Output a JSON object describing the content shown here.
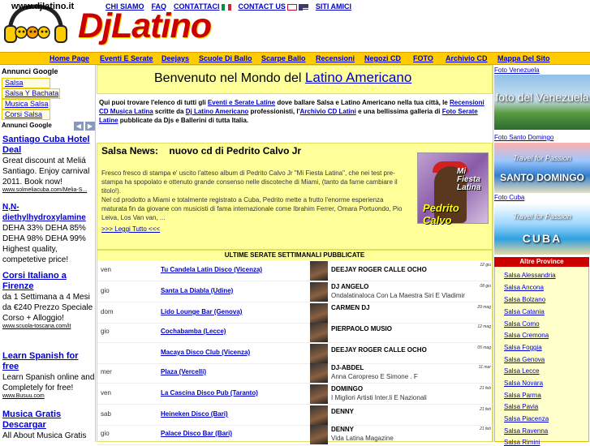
{
  "header": {
    "site_url": "www.djlatino.it",
    "brand": "DjLatino",
    "top_links": [
      "CHI SIAMO",
      "FAQ",
      "CONTATTACI",
      "CONTACT US",
      "SITI AMICI"
    ]
  },
  "nav": [
    "Home Page",
    "Eventi E Serate",
    "Deejays",
    "Scuole Di Ballo",
    "Scarpe Ballo",
    "Recensioni",
    "Negozi CD",
    "FOTO",
    "Archivio CD",
    "Mappa Del Sito"
  ],
  "left": {
    "annunci_title": "Annunci Google",
    "links": [
      "Salsa",
      "Salsa Y Bachata",
      "Musica Salsa",
      "Corsi Salsa"
    ],
    "annunci_label": "Annunci Google",
    "ads": [
      {
        "title": "Santiago Cuba Hotel Deal",
        "desc": "Great discount at Meliá Santiago. Enjoy carnival 2011. Book now!",
        "url": "www.solmeliacuba.com/Melia-S..."
      },
      {
        "title": "N,N-diethylhydroxylamine",
        "desc": "DEHA 33% DEHA 85% DEHA 98% DEHA 99% Highest quality, competetive price!",
        "url": ""
      },
      {
        "title": "Corsi Italiano a Firenze",
        "desc": "da 1 Settimana a 4 Mesi da €240 Prezzo Speciale Corso + Alloggio!",
        "url": "www.scuola-toscana.com/it"
      },
      {
        "title": "Learn Spanish for free",
        "desc": "Learn Spanish online and Completely for free!",
        "url": "www.Busuu.com"
      },
      {
        "title": "Musica Gratis Descargar",
        "desc": "All About Musica Gratis",
        "url": ""
      }
    ]
  },
  "main": {
    "welcome_prefix": "Benvenuto nel Mondo del",
    "welcome_link": "Latino Americano",
    "intro": {
      "p1": "Qui puoi trovare l'elenco di tutti gli",
      "l1": "Eventi e Serate Latine",
      "p2": "dove ballare Salsa e Latino Americano nella tua città, le",
      "l2": "Recensioni CD Musica Latina",
      "p3": "scritte da",
      "l3": "Dj Latino Americano",
      "p4": "professionisti, l'",
      "l4": "Archivio CD Latini",
      "p5": "e una bellissima galleria di",
      "l5": "Foto Serate Latine",
      "p6": "pubblicate da Djs e Ballerini di tutta Italia."
    },
    "news": {
      "label": "Salsa News:",
      "headline": "nuovo cd di Pedrito Calvo Jr",
      "body1": "Fresco fresco di stampa e' uscito l'atteso album di Pedrito Calvo Jr \"Mi Fiesta Latina\", che nei test pre-stampa ha spopolato e ottenuto grande consenso nelle discoteche di Miami, (tanto da farne cambiare il titolo!).",
      "body2": "Nel cd prodotto a Miami e totalmente registrato a Cuba, Pedrito mette a frutto l'enorme esperienza maturata fin da giovane con musicisti di fama internazionale come Ibrahim Ferrer, Omara Portuondo, Pio Leiva, Los Van van, ...",
      "more": ">>> Leggi Tutto <<<",
      "cd_title": "Mi Fiesta Latina",
      "cd_artist": "Pedrito Calvo"
    },
    "events_title": "ULTIME SERATE SETTIMANALI PUBBLICATE",
    "events": [
      {
        "day": "ven",
        "venue": "Tu Candela Latin Disco (Vicenza)",
        "dj": "DEEJAY ROGER CALLE OCHO",
        "sub": "",
        "date": "12 giu"
      },
      {
        "day": "gio",
        "venue": "Santa La Diabla (Udine)",
        "dj": "DJ ANGELO",
        "sub": "Ondalatinaloca Con La Maestra Siri E Vladimir",
        "date": "08 giu"
      },
      {
        "day": "dom",
        "venue": "Lido Lounge Bar (Genova)",
        "dj": "CARMEN DJ",
        "sub": "",
        "date": "29 mag"
      },
      {
        "day": "gio",
        "venue": "Cochabamba (Lecce)",
        "dj": "PIERPAOLO MUSIO",
        "sub": "",
        "date": "12 mag"
      },
      {
        "day": "",
        "venue": "Macaya Disco Club (Vicenza)",
        "dj": "DEEJAY ROGER CALLE OCHO",
        "sub": "",
        "date": "05 mag"
      },
      {
        "day": "mer",
        "venue": "Plaza (Vercelli)",
        "dj": "DJ-ABDEL",
        "sub": "Anna Caropreso E Simone . F",
        "date": "11 mar"
      },
      {
        "day": "ven",
        "venue": "La Cascina Disco Pub (Taranto)",
        "dj": "DOMINGO",
        "sub": "I Migliori Artisti Inter.li E Nazionali",
        "date": "21 feb"
      },
      {
        "day": "sab",
        "venue": "Heineken Disco (Bari)",
        "dj": "DENNY",
        "sub": "",
        "date": "21 feb"
      },
      {
        "day": "gio",
        "venue": "Palace Disco Bar (Bari)",
        "dj": "DENNY",
        "sub": "Vida Latina Magazine",
        "date": "21 feb"
      }
    ]
  },
  "right": {
    "photos": [
      {
        "label": "Foto Venezuela",
        "caption": "foto del Venezuela"
      },
      {
        "label": "Foto Santo Domingo",
        "caption": "SANTO DOMINGO"
      },
      {
        "label": "Foto Cuba",
        "caption": "CUBA"
      }
    ],
    "travel_tag": "Travel for Passion",
    "prov_title": "Altre Province",
    "provinces": [
      "Salsa Alessandria",
      "Salsa Ancona",
      "Salsa Bolzano",
      "Salsa Catania",
      "Salsa Como",
      "Salsa Cremona",
      "Salsa Foggia",
      "Salsa Genova",
      "Salsa Lecce",
      "Salsa Novara",
      "Salsa Parma",
      "Salsa Pavia",
      "Salsa Piacenza",
      "Salsa Ravenna",
      "Salsa Rimini"
    ]
  }
}
